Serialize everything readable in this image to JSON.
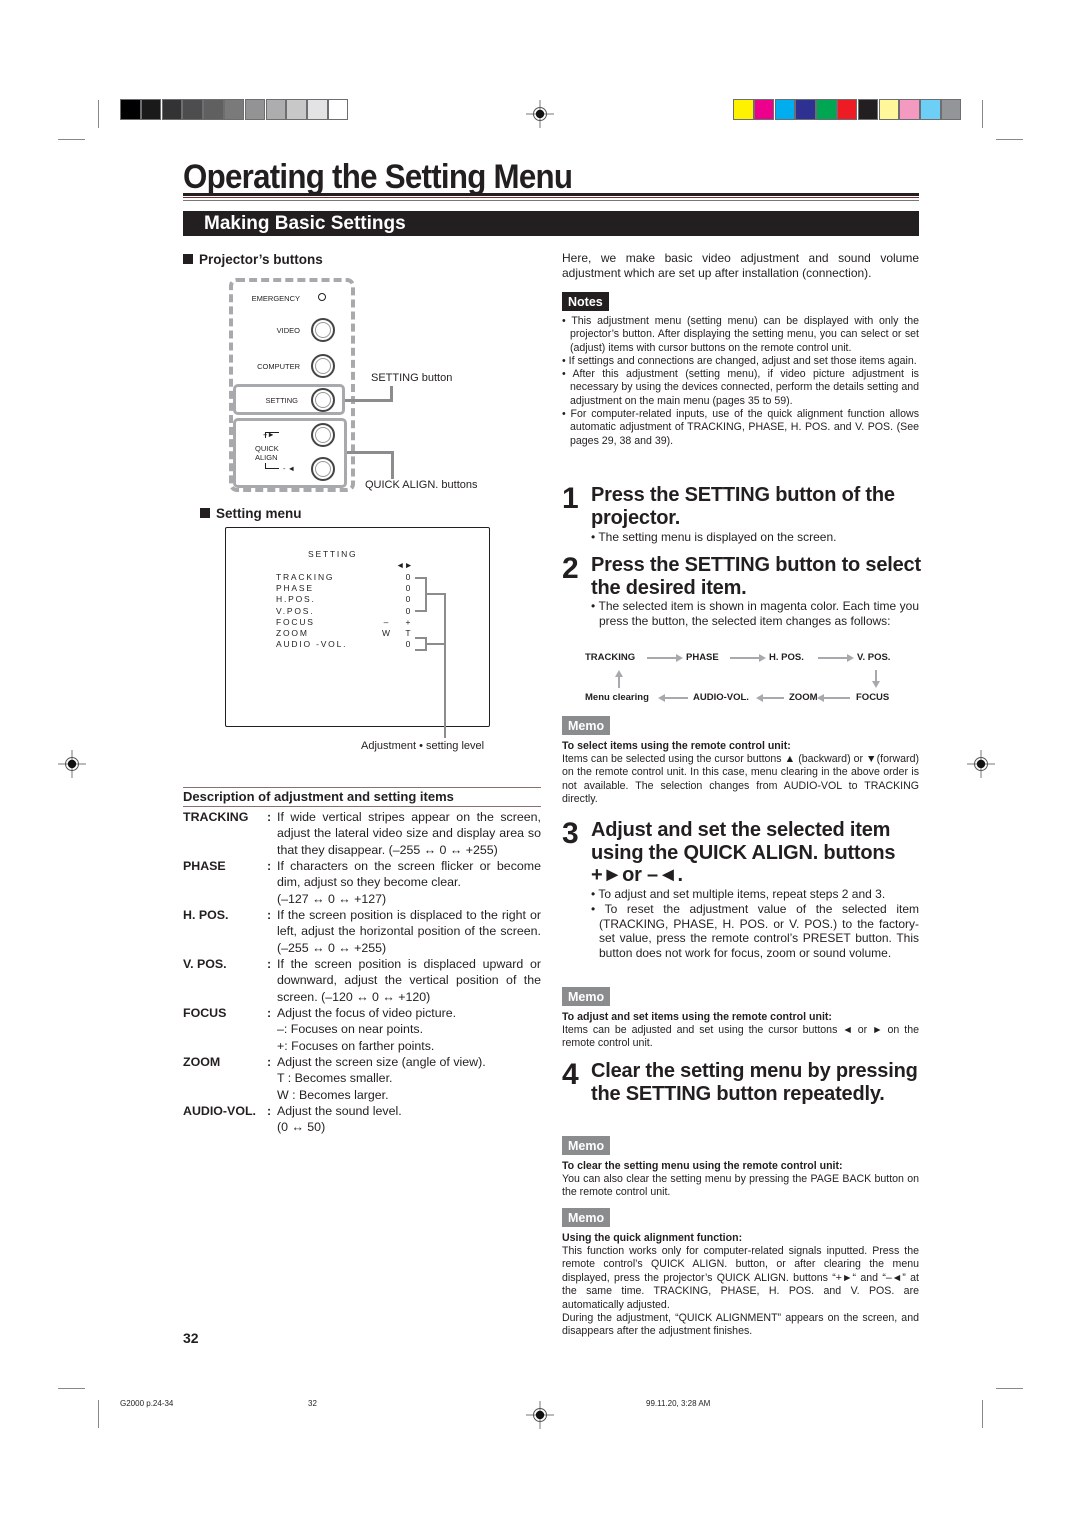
{
  "print_marks": {
    "gray_swatches": [
      "#000000",
      "#1a1a1a",
      "#333333",
      "#4d4d4d",
      "#606060",
      "#7a7a7a",
      "#939393",
      "#adadad",
      "#c8c8c8",
      "#e3e3e3",
      "#ffffff"
    ],
    "color_swatches": [
      "#fff200",
      "#ec008c",
      "#00aeef",
      "#2e3192",
      "#00a651",
      "#ed1c24",
      "#231f20",
      "#fff799",
      "#f49ac1",
      "#6dcff6",
      "#939598"
    ]
  },
  "page": {
    "title": "Operating the Setting Menu",
    "section": "Making Basic Settings",
    "page_number": "32"
  },
  "projector_buttons": {
    "heading": "Projector’s buttons",
    "labels": {
      "emergency": "EMERGENCY",
      "video": "VIDEO",
      "computer": "COMPUTER",
      "setting": "SETTING",
      "quick": "QUICK",
      "align": "ALIGN",
      "plus": "+►",
      "minus": "- ◄"
    },
    "callouts": {
      "setting_button": "SETTING button",
      "quick_align_buttons": "QUICK ALIGN. buttons"
    }
  },
  "setting_menu": {
    "heading": "Setting menu",
    "screen_title": "SETTING",
    "arrows": "◄►",
    "items": [
      {
        "name": "TRACKING",
        "left": "",
        "value": "0"
      },
      {
        "name": "PHASE",
        "left": "",
        "value": "0"
      },
      {
        "name": "H.POS.",
        "left": "",
        "value": "0"
      },
      {
        "name": "V.POS.",
        "left": "",
        "value": "0"
      },
      {
        "name": "FOCUS",
        "left": "–",
        "value": "+"
      },
      {
        "name": "ZOOM",
        "left": "W",
        "value": "T"
      },
      {
        "name": "AUDIO -VOL.",
        "left": "",
        "value": "0"
      }
    ],
    "callout": "Adjustment • setting level"
  },
  "description": {
    "heading": "Description of adjustment and setting items",
    "items": [
      {
        "term": "TRACKING",
        "lines": [
          "If wide vertical stripes appear on the screen, adjust the lateral video size and display area so that they disappear. (–255 ↔ 0 ↔ +255)"
        ]
      },
      {
        "term": "PHASE",
        "lines": [
          "If characters on the screen flicker or become dim, adjust so they become clear.",
          "(–127 ↔ 0 ↔ +127)"
        ]
      },
      {
        "term": "H. POS.",
        "lines": [
          "If the screen position is displaced to the right or left, adjust the horizontal position of the screen. (–255 ↔ 0 ↔ +255)"
        ]
      },
      {
        "term": "V. POS.",
        "lines": [
          "If the screen position is displaced upward or downward, adjust the vertical position of the screen. (–120 ↔ 0 ↔ +120)"
        ]
      },
      {
        "term": "FOCUS",
        "lines": [
          "Adjust the focus of video picture.",
          "–: Focuses on near points.",
          "+: Focuses on farther points."
        ]
      },
      {
        "term": "ZOOM",
        "lines": [
          "Adjust the screen size (angle of view).",
          "T  : Becomes smaller.",
          "W : Becomes larger."
        ]
      },
      {
        "term": "AUDIO-VOL.",
        "lines": [
          "Adjust the sound level.",
          "(0 ↔ 50)"
        ]
      }
    ]
  },
  "intro": "Here, we make basic video adjustment and sound volume adjustment which are set up after installation (connection).",
  "notes": {
    "label": "Notes",
    "items": [
      "This adjustment menu (setting menu) can be displayed with only the projector’s button. After displaying the setting menu, you can select or set (adjust) items with cursor buttons on the remote control unit.",
      "If settings and connections are changed, adjust and set those items again.",
      "After this adjustment (setting menu), if video picture adjustment is necessary by using the devices connected, perform the details setting and adjustment on the main menu (pages 35 to 59).",
      "For computer-related inputs, use of the quick alignment function allows automatic adjustment of TRACKING, PHASE, H. POS. and V. POS. (See pages 29, 38 and 39)."
    ]
  },
  "steps": [
    {
      "num": "1",
      "title": "Press the SETTING button of the projector.",
      "bullets": [
        "The setting menu is displayed on the screen."
      ]
    },
    {
      "num": "2",
      "title": "Press the SETTING button to select the desired item.",
      "bullets": [
        "The selected item is shown in magenta color. Each time you press the button, the selected item changes as follows:"
      ]
    },
    {
      "num": "3",
      "title": "Adjust and set the selected item using the QUICK ALIGN. buttons +►or –◄.",
      "bullets": [
        "To adjust and set multiple items, repeat steps 2 and 3.",
        "To reset the adjustment value of the selected item (TRACKING, PHASE, H. POS. or V. POS.) to the factory-set value, press the remote control’s PRESET button. This button does not work for focus, zoom or sound volume."
      ]
    },
    {
      "num": "4",
      "title": "Clear the setting menu by pressing the SETTING button repeatedly.",
      "bullets": []
    }
  ],
  "flow": {
    "top": [
      "TRACKING",
      "PHASE",
      "H. POS.",
      "V. POS."
    ],
    "bottom": [
      "Menu clearing",
      "AUDIO-VOL.",
      "ZOOM",
      "FOCUS"
    ]
  },
  "memos": [
    {
      "label": "Memo",
      "title": "To select items using the remote control unit:",
      "body": "Items can be selected using the cursor buttons ▲ (backward) or ▼(forward) on the remote control unit. In this case, menu clearing in the above order is not available. The selection changes from AUDIO-VOL to TRACKING directly."
    },
    {
      "label": "Memo",
      "title": "To adjust and set items using the remote control unit:",
      "body": "Items can be adjusted and set using the cursor buttons ◄ or ► on the remote control unit."
    },
    {
      "label": "Memo",
      "title": "To clear the setting menu using the remote control unit:",
      "body": "You can also clear the setting menu by pressing the PAGE BACK button on the remote control unit."
    },
    {
      "label": "Memo",
      "title": "Using the quick alignment function:",
      "body": "This function works only for computer-related signals inputted. Press the remote control’s QUICK ALIGN. button, or after clearing the menu displayed, press the projector’s QUICK ALIGN. buttons “+►“ and “–◄” at the same time. TRACKING, PHASE, H. POS. and V. POS. are automatically adjusted.",
      "body2": "During the adjustment, “QUICK ALIGNMENT” appears on the screen, and disappears after the adjustment finishes."
    }
  ],
  "footer": {
    "file": "G2000  p.24-34",
    "page": "32",
    "date": "99.11.20, 3:28 AM"
  }
}
